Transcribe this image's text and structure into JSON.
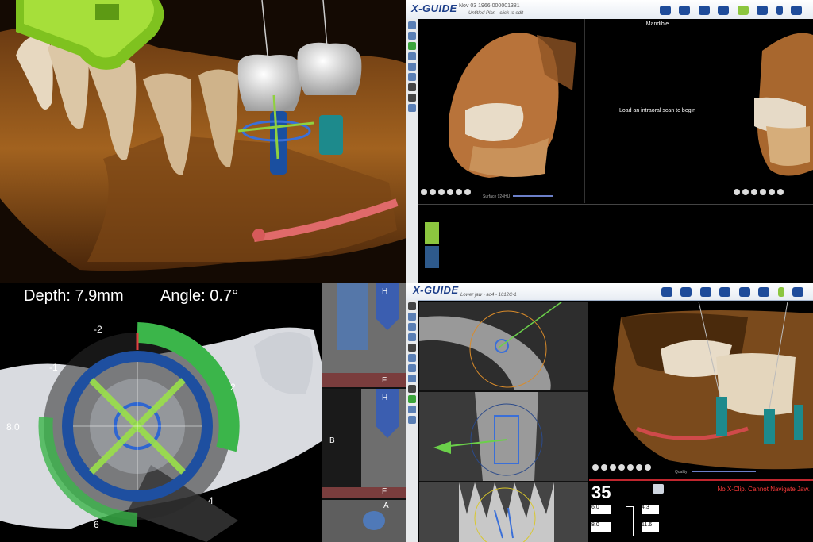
{
  "q1": {
    "caption": ""
  },
  "q2": {
    "logo": "X-GUIDE",
    "patient_line": "Nov 03 1966 000001381",
    "plan_line": "Untitled Plan - click to edit",
    "center_title": "Mandible",
    "center_message": "Load an intraoral scan to begin",
    "slider_label": "Surface 924HU",
    "swatches": [
      "#8cc63f",
      "#2e5a8c"
    ]
  },
  "q3": {
    "depth_label": "Depth: 7.9mm",
    "angle_label": "Angle: 0.7°",
    "dial_labels": {
      "top": "-2",
      "upper_left": "-1",
      "left": "8.0",
      "right_upper": "2",
      "lower": "4",
      "bottom": "6"
    },
    "slice_labels": {
      "h1": "H",
      "f1": "F",
      "b": "B",
      "h2": "H",
      "f2": "F",
      "a": "A"
    }
  },
  "q4": {
    "logo": "X-GUIDE",
    "plan_line": "Lower jaw - ao4 - 1012C-1",
    "slider_label": "Quality",
    "implant_number": "35",
    "warning": "No X-Clip. Cannot Navigate Jaw.",
    "fields": {
      "f1": "6.0",
      "f2": "8.0",
      "f3": "4.3",
      "f4": "11.6"
    }
  }
}
